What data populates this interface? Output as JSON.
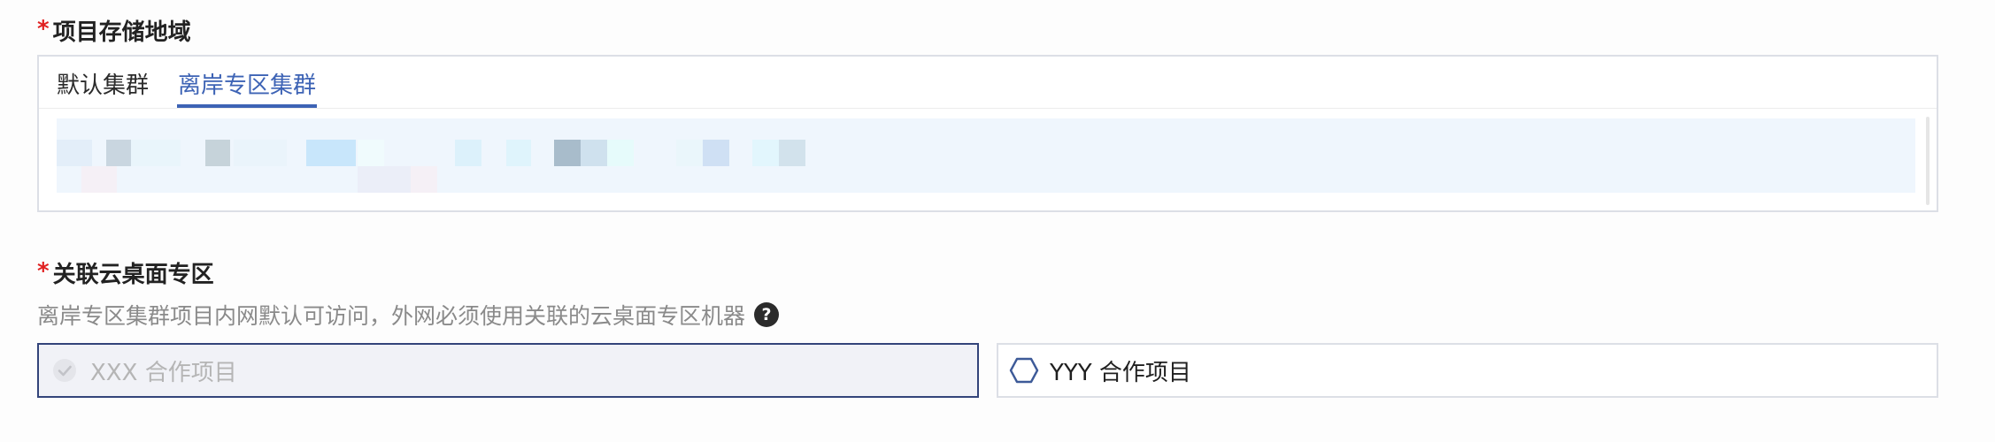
{
  "storage_region": {
    "required_mark": "*",
    "label": "项目存储地域",
    "tabs": [
      {
        "label": "默认集群",
        "active": false
      },
      {
        "label": "离岸专区集群",
        "active": true
      }
    ],
    "accent_color": "#3d63b5"
  },
  "desktop_zone": {
    "required_mark": "*",
    "label": "关联云桌面专区",
    "hint": "离岸专区集群项目内网默认可访问，外网必须使用关联的云桌面专区机器",
    "help_icon": "question-circle-icon",
    "options": [
      {
        "label": "XXX 合作项目",
        "state": "selected-disabled",
        "icon": "check-circle-icon"
      },
      {
        "label": "YYY 合作项目",
        "state": "unselected",
        "icon": "hexagon-icon"
      }
    ]
  }
}
